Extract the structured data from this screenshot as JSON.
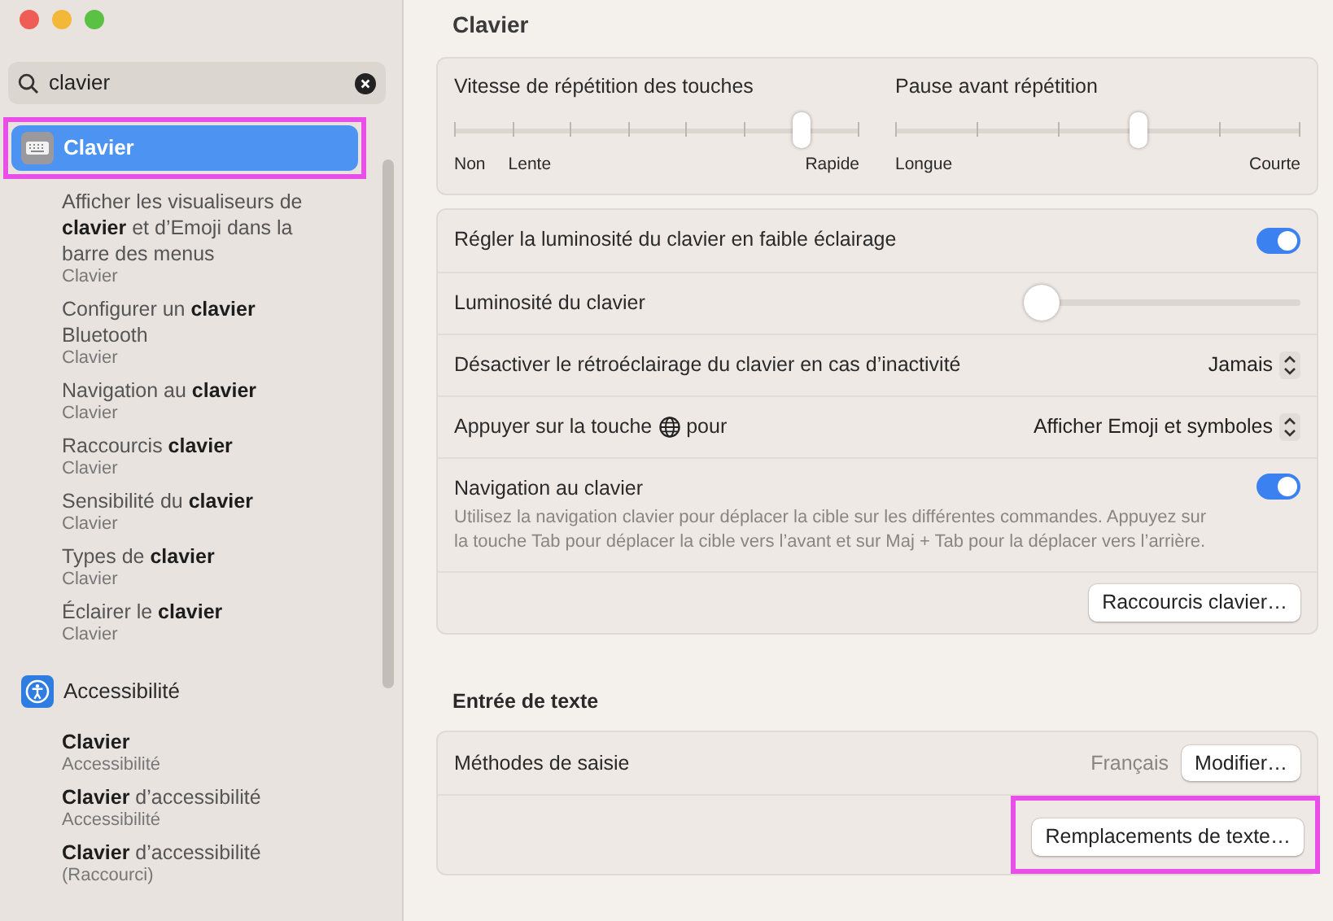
{
  "search": {
    "value": "clavier"
  },
  "sidebar": {
    "groups": [
      {
        "label": "Clavier",
        "kind": "keyboard",
        "selected": true,
        "highlighted": true,
        "results": [
          {
            "title": "Afficher les visualiseurs de **clavier** et d’Emoji dans la barre des menus",
            "subtitle": "Clavier"
          },
          {
            "title": "Configurer un **clavier** Bluetooth",
            "subtitle": "Clavier"
          },
          {
            "title": "Navigation au **clavier**",
            "subtitle": "Clavier"
          },
          {
            "title": "Raccourcis **clavier**",
            "subtitle": "Clavier"
          },
          {
            "title": "Sensibilité du **clavier**",
            "subtitle": "Clavier"
          },
          {
            "title": "Types de **clavier**",
            "subtitle": "Clavier"
          },
          {
            "title": "Éclairer le **clavier**",
            "subtitle": "Clavier"
          }
        ]
      },
      {
        "label": "Accessibilité",
        "kind": "accessibility",
        "selected": false,
        "highlighted": false,
        "results": [
          {
            "title": "**Clavier**",
            "subtitle": "Accessibilité"
          },
          {
            "title": "**Clavier** d’accessibilité",
            "subtitle": "Accessibilité"
          },
          {
            "title": "**Clavier** d’accessibilité",
            "subtitle": "(Raccourci)"
          }
        ]
      }
    ]
  },
  "main": {
    "title": "Clavier",
    "sliders": [
      {
        "label": "Vitesse de répétition des touches",
        "level": 0.857,
        "scale_labels": [
          "Non",
          "Lente",
          "Rapide"
        ]
      },
      {
        "label": "Pause avant répétition",
        "level": 0.6,
        "scale_labels": [
          "Longue",
          "Courte"
        ]
      }
    ],
    "settings": [
      {
        "kind": "toggle",
        "label": "Régler la luminosité du clavier en faible éclairage",
        "on": true
      },
      {
        "kind": "slider",
        "label": "Luminosité du clavier",
        "level": 0
      },
      {
        "kind": "popup",
        "label": "Désactiver le rétroéclairage du clavier en cas d’inactivité",
        "value": "Jamais"
      },
      {
        "kind": "popup",
        "label": "Appuyer sur la touche",
        "label_after": "pour",
        "value": "Afficher Emoji et symboles"
      },
      {
        "kind": "toggle",
        "label": "Navigation au clavier",
        "on": true,
        "description": "Utilisez la navigation clavier pour déplacer la cible sur les différentes commandes. Appuyez sur la touche Tab pour déplacer la cible vers l’avant et sur Maj + Tab pour la déplacer vers l’arrière."
      },
      {
        "kind": "button",
        "button": "Raccourcis clavier…",
        "highlighted": false
      }
    ],
    "text_input": {
      "title": "Entrée de texte",
      "rows": [
        {
          "kind": "button",
          "label": "Méthodes de saisie",
          "value": "Français",
          "button": "Modifier…",
          "highlighted": false
        },
        {
          "kind": "button",
          "button": "Remplacements de texte…",
          "highlighted": true
        }
      ]
    }
  }
}
